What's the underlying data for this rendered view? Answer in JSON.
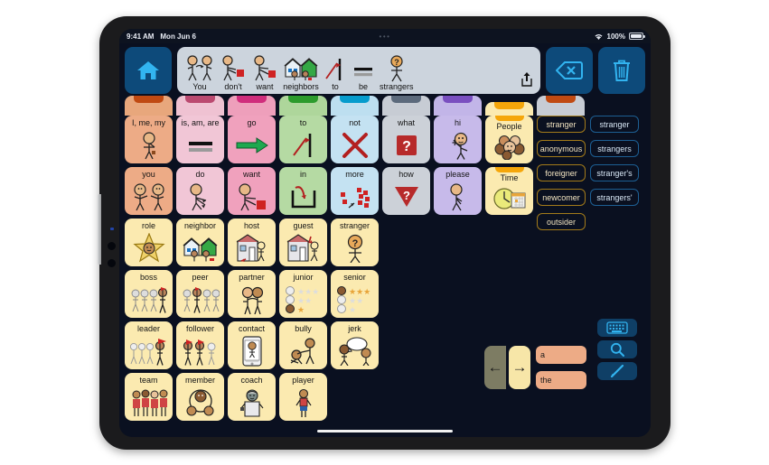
{
  "device": {
    "name": "ipad-tablet"
  },
  "status_bar": {
    "time": "9:41 AM",
    "date": "Mon Jun 6",
    "center_dots": "•••",
    "battery_percent": "100%",
    "wifi_icon": "wifi-icon",
    "battery_icon": "battery-icon"
  },
  "toolbar": {
    "home_button": {
      "name": "home-button",
      "icon": "home-icon"
    },
    "share_button": {
      "name": "share-button",
      "icon": "share-icon"
    },
    "backspace_button": {
      "name": "backspace-button",
      "icon": "backspace-icon"
    },
    "clear_button": {
      "name": "clear-button",
      "icon": "trash-icon"
    },
    "sentence": [
      {
        "label": "You",
        "symbol": "two-people-talking-icon"
      },
      {
        "label": "don't",
        "symbol": "person-refuse-red-square-icon"
      },
      {
        "label": "want",
        "symbol": "person-reaching-red-square-icon"
      },
      {
        "label": "neighbors",
        "symbol": "two-houses-people-icon"
      },
      {
        "label": "to",
        "symbol": "arrow-to-line-icon"
      },
      {
        "label": "be",
        "symbol": "equals-bar-icon"
      },
      {
        "label": "strangers",
        "symbol": "person-question-mark-icon"
      }
    ]
  },
  "tabs": [
    {
      "name": "tab-pronouns",
      "body": "#e8a77c",
      "notch": "#c04a12"
    },
    {
      "name": "tab-verbs-be",
      "body": "#efc2d2",
      "notch": "#bb4a70"
    },
    {
      "name": "tab-verbs",
      "body": "#ee9fbb",
      "notch": "#d02d7c"
    },
    {
      "name": "tab-prepositions",
      "body": "#aed69b",
      "notch": "#2c9b2c"
    },
    {
      "name": "tab-negation",
      "body": "#bddff0",
      "notch": "#069ccd"
    },
    {
      "name": "tab-questions",
      "body": "#c7ccd4",
      "notch": "#5c6a7c"
    },
    {
      "name": "tab-social",
      "body": "#c2b5e8",
      "notch": "#7a4fc0"
    },
    {
      "name": "tab-people-folder",
      "body": "#fbeab0",
      "notch": "#f5a60a"
    },
    {
      "name": "tab-groups",
      "body": "#c7ccd4",
      "notch": "#c04a12"
    }
  ],
  "grid": {
    "rows": [
      [
        {
          "label": "I, me, my",
          "symbol": "person-pointing-self-icon",
          "bg": "#edab86",
          "type": "word"
        },
        {
          "label": "is, am, are",
          "symbol": "equals-icon",
          "bg": "#f1c6d6",
          "type": "word"
        },
        {
          "label": "go",
          "symbol": "green-arrow-right-icon",
          "bg": "#f0a1bd",
          "type": "word"
        },
        {
          "label": "to",
          "symbol": "arrow-to-line-icon",
          "bg": "#b5daa3",
          "type": "word"
        },
        {
          "label": "not",
          "symbol": "red-x-icon",
          "bg": "#c4e2f2",
          "type": "word"
        },
        {
          "label": "what",
          "symbol": "red-question-square-icon",
          "bg": "#ccd1d8",
          "type": "word"
        },
        {
          "label": "hi",
          "symbol": "person-waving-icon",
          "bg": "#c7baea",
          "type": "word"
        },
        {
          "label": "People",
          "symbol": "group-of-faces-icon",
          "bg": "#fbeab0",
          "type": "folder"
        }
      ],
      [
        {
          "label": "you",
          "symbol": "two-people-pointing-icon",
          "bg": "#edab86",
          "type": "word"
        },
        {
          "label": "do",
          "symbol": "person-action-icon",
          "bg": "#f1c6d6",
          "type": "word"
        },
        {
          "label": "want",
          "symbol": "person-reaching-red-square-icon",
          "bg": "#f0a1bd",
          "type": "word"
        },
        {
          "label": "in",
          "symbol": "arrow-into-container-icon",
          "bg": "#b5daa3",
          "type": "word"
        },
        {
          "label": "more",
          "symbol": "red-blocks-pile-icon",
          "bg": "#c4e2f2",
          "type": "word"
        },
        {
          "label": "how",
          "symbol": "red-question-triangle-icon",
          "bg": "#ccd1d8",
          "type": "word"
        },
        {
          "label": "please",
          "symbol": "person-asking-icon",
          "bg": "#c7baea",
          "type": "word"
        },
        {
          "label": "Time",
          "symbol": "clock-calendar-icon",
          "bg": "#fbeab0",
          "type": "folder"
        }
      ],
      [
        {
          "label": "role",
          "symbol": "star-face-icon",
          "bg": "#fbeab0",
          "type": "word"
        },
        {
          "label": "neighbor",
          "symbol": "two-houses-people-icon",
          "bg": "#fbeab0",
          "type": "word"
        },
        {
          "label": "host",
          "symbol": "house-welcoming-person-icon",
          "bg": "#fbeab0",
          "type": "word"
        },
        {
          "label": "guest",
          "symbol": "person-entering-house-icon",
          "bg": "#fbeab0",
          "type": "word"
        },
        {
          "label": "stranger",
          "symbol": "person-question-mark-icon",
          "bg": "#fbeab0",
          "type": "word"
        }
      ],
      [
        {
          "label": "boss",
          "symbol": "leader-with-group-icon",
          "bg": "#fbeab0",
          "type": "word"
        },
        {
          "label": "peer",
          "symbol": "equal-group-icon",
          "bg": "#fbeab0",
          "type": "word"
        },
        {
          "label": "partner",
          "symbol": "two-people-together-icon",
          "bg": "#fbeab0",
          "type": "word"
        },
        {
          "label": "junior",
          "symbol": "low-rank-stars-icon",
          "bg": "#fbeab0",
          "type": "word"
        },
        {
          "label": "senior",
          "symbol": "high-rank-stars-icon",
          "bg": "#fbeab0",
          "type": "word"
        }
      ],
      [
        {
          "label": "leader",
          "symbol": "person-leading-group-icon",
          "bg": "#fbeab0",
          "type": "word"
        },
        {
          "label": "follower",
          "symbol": "people-following-icon",
          "bg": "#fbeab0",
          "type": "word"
        },
        {
          "label": "contact",
          "symbol": "phone-contact-icon",
          "bg": "#fbeab0",
          "type": "word"
        },
        {
          "label": "bully",
          "symbol": "person-pushing-person-icon",
          "bg": "#fbeab0",
          "type": "word"
        },
        {
          "label": "jerk",
          "symbol": "person-insulting-icon",
          "bg": "#fbeab0",
          "type": "word"
        }
      ],
      [
        {
          "label": "team",
          "symbol": "group-in-uniform-icon",
          "bg": "#fbeab0",
          "type": "word"
        },
        {
          "label": "member",
          "symbol": "circle-of-faces-icon",
          "bg": "#fbeab0",
          "type": "word"
        },
        {
          "label": "coach",
          "symbol": "coach-whistle-icon",
          "bg": "#fbeab0",
          "type": "word"
        },
        {
          "label": "player",
          "symbol": "athlete-icon",
          "bg": "#fbeab0",
          "type": "word"
        }
      ]
    ]
  },
  "predictions": {
    "synonyms": [
      "stranger",
      "anonymous",
      "foreigner",
      "newcomer",
      "outsider"
    ],
    "inflections": [
      "stranger",
      "strangers",
      "stranger's",
      "strangers'"
    ]
  },
  "navigation": {
    "back_label": "←",
    "forward_label": "→",
    "back_name": "back-button",
    "forward_name": "forward-button"
  },
  "articles": [
    "a",
    "the"
  ],
  "tools": [
    {
      "name": "keyboard-button",
      "icon": "keyboard-icon"
    },
    {
      "name": "search-button",
      "icon": "search-icon"
    },
    {
      "name": "draw-button",
      "icon": "pencil-icon"
    }
  ]
}
